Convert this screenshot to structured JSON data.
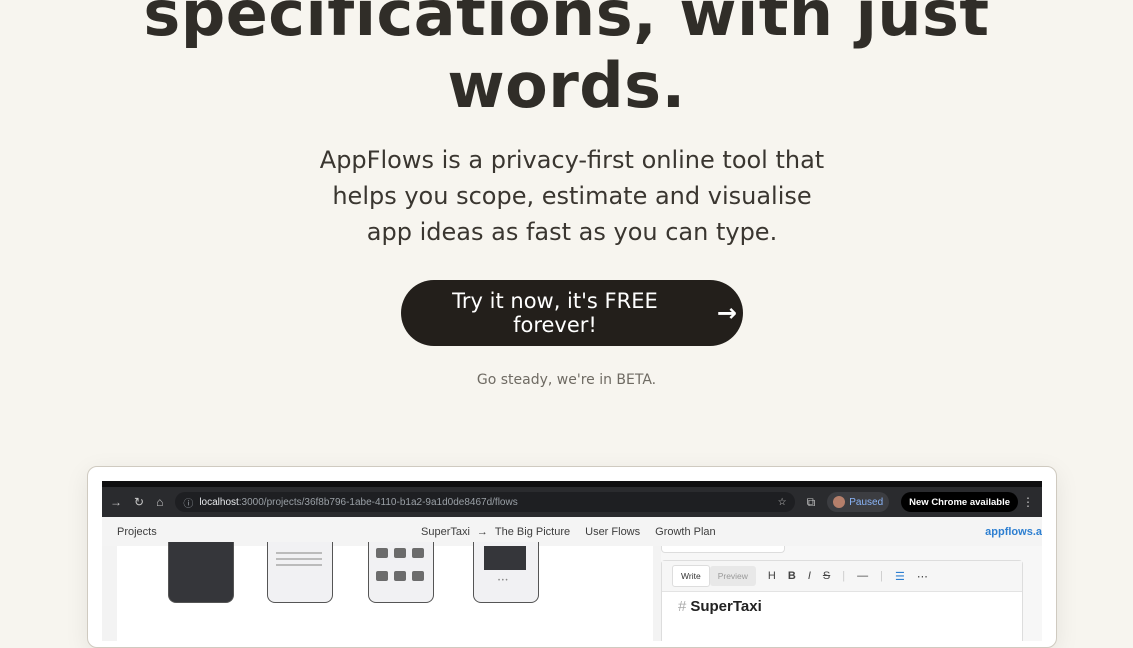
{
  "hero": {
    "headline_line1": "specifications, with just",
    "headline_line2": "words.",
    "subtitle": "AppFlows is a privacy-first online tool that helps you scope, estimate and visualise app ideas as fast as you can type.",
    "cta_label": "Try it now, it's FREE forever!",
    "cta_arrow": "→",
    "beta_note": "Go steady, we're in BETA."
  },
  "browser": {
    "nav_forward": "→",
    "nav_reload": "↻",
    "nav_home": "⌂",
    "url_info_icon": "ⓘ",
    "url_host": "localhost",
    "url_path": ":3000/projects/36f8b796-1abe-4110-b1a2-9a1d0de8467d/flows",
    "bookmark_star": "☆",
    "extensions_icon": "⧉",
    "profile_status": "Paused",
    "update_notice": "New Chrome available",
    "menu_icon": "⋮"
  },
  "app_nav": {
    "projects": "Projects",
    "project_name": "SuperTaxi",
    "crumb_arrow": "→",
    "tabs": [
      "The Big Picture",
      "User Flows",
      "Growth Plan"
    ],
    "brand": "appflows.a"
  },
  "editor": {
    "tab_write": "Write",
    "tab_preview": "Preview",
    "tools": [
      "H",
      "B",
      "I",
      "S",
      "—",
      "☰",
      "⋯"
    ],
    "hash": "#",
    "doc_title": "SuperTaxi"
  },
  "colors": {
    "background": "#f7f5ef",
    "cta_bg": "#231f1b",
    "brand_blue": "#2d7fd1"
  }
}
